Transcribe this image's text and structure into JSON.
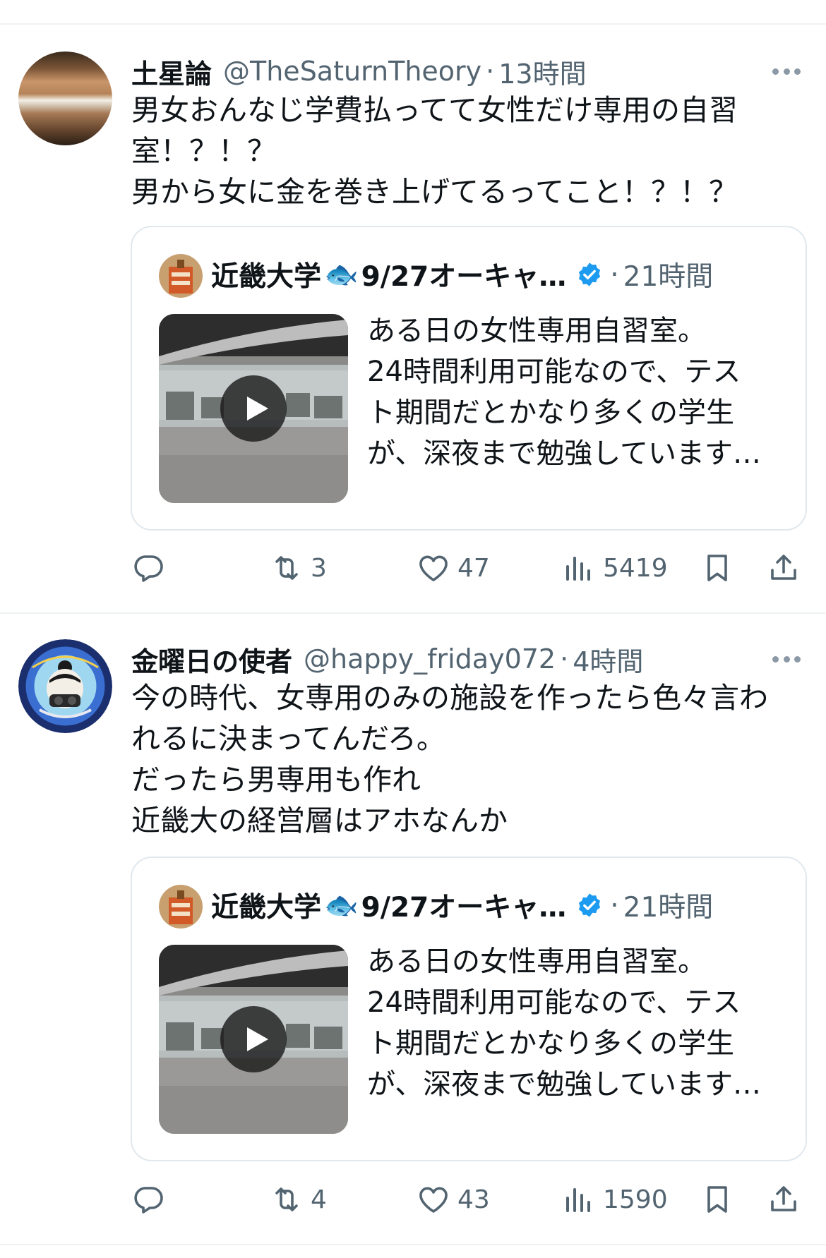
{
  "tweets": [
    {
      "author": {
        "name": "土星論",
        "handle": "@TheSaturnTheory",
        "time": "13時間"
      },
      "text_lines": [
        "男女おんなじ学費払ってて女性だけ専用の自習",
        "室！？！？",
        "男から女に金を巻き上げてるってこと！？！？"
      ],
      "quote": {
        "name": "近畿大学",
        "emoji": "🐟",
        "name_suffix": "9/27オーキャ…",
        "time": "21時間",
        "text_lines": [
          "ある日の女性専用自習室。",
          "24時間利用可能なので、テス",
          "ト期間だとかなり多くの学生",
          "が、深夜まで勉強しています…"
        ]
      },
      "actions": {
        "reply": "",
        "retweets": "3",
        "likes": "47",
        "views": "5419"
      }
    },
    {
      "author": {
        "name": "金曜日の使者",
        "handle": "@happy_friday072",
        "time": "4時間"
      },
      "text_lines": [
        "今の時代、女専用のみの施設を作ったら色々言わ",
        "れるに決まってんだろ。",
        "だったら男専用も作れ",
        "近畿大の経営層はアホなんか"
      ],
      "quote": {
        "name": "近畿大学",
        "emoji": "🐟",
        "name_suffix": "9/27オーキャ…",
        "time": "21時間",
        "text_lines": [
          "ある日の女性専用自習室。",
          "24時間利用可能なので、テス",
          "ト期間だとかなり多くの学生",
          "が、深夜まで勉強しています…"
        ]
      },
      "actions": {
        "reply": "",
        "retweets": "4",
        "likes": "43",
        "views": "1590"
      }
    }
  ],
  "separator": "·",
  "colors": {
    "text": "#0f1419",
    "secondary": "#536471",
    "verified": "#1d9bf0",
    "border": "#e1e8ed"
  },
  "icons": {
    "reply": "reply-icon",
    "retweet": "retweet-icon",
    "like": "heart-icon",
    "views": "views-icon",
    "bookmark": "bookmark-icon",
    "share": "share-icon",
    "more": "more-icon",
    "verified": "verified-badge-icon",
    "play": "play-icon"
  }
}
